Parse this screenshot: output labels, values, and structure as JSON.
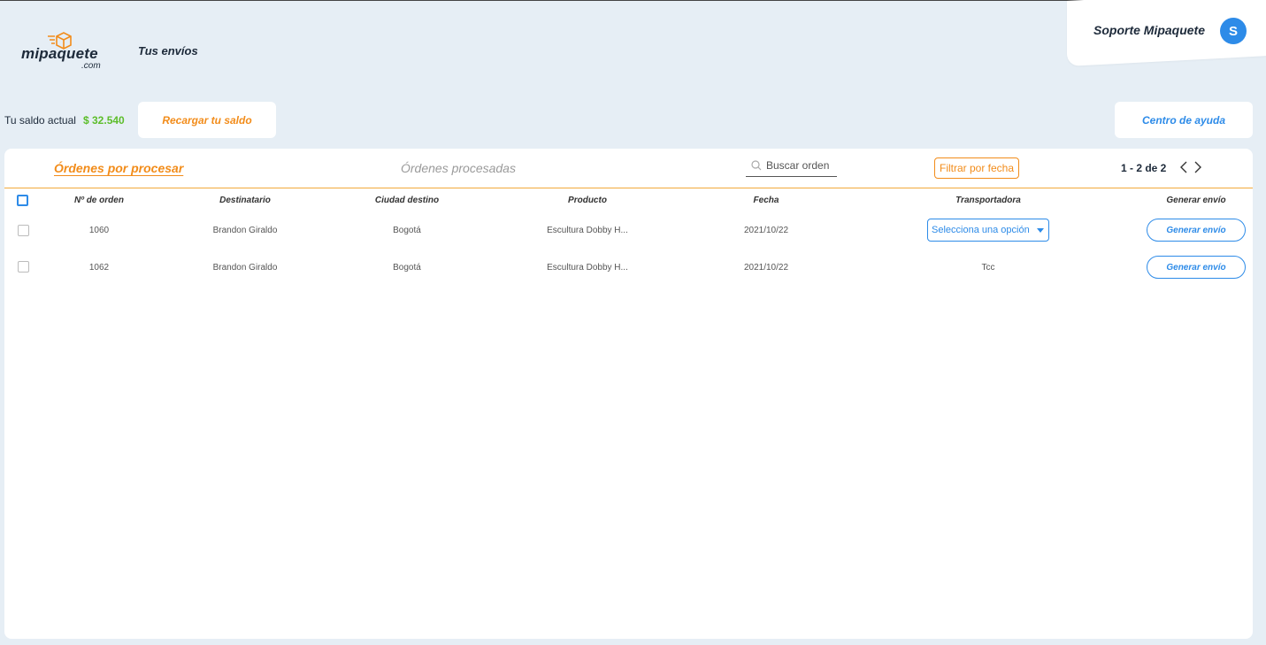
{
  "header": {
    "logo_main": "mipaquete",
    "logo_suffix": ".com",
    "page_title": "Tus envíos",
    "support_name": "Soporte Mipaquete",
    "avatar_initial": "S"
  },
  "balance": {
    "label": "Tu saldo actual",
    "value": "$ 32.540",
    "recharge_label": "Recargar tu saldo",
    "help_label": "Centro de ayuda"
  },
  "tabs": {
    "active": "Órdenes por procesar",
    "inactive": "Órdenes procesadas"
  },
  "search": {
    "placeholder": "Buscar orden"
  },
  "filter_label": "Filtrar por fecha",
  "pager": {
    "text": "1 - 2 de 2"
  },
  "table": {
    "headers": [
      "Nº de orden",
      "Destinatario",
      "Ciudad destino",
      "Producto",
      "Fecha",
      "Transportadora",
      "Generar envío"
    ],
    "rows": [
      {
        "order": "1060",
        "recipient": "Brandon Giraldo",
        "city": "Bogotá",
        "product": "Escultura Dobby H...",
        "date": "2021/10/22",
        "carrier": "Selecciona una opción",
        "action": "Generar envío"
      },
      {
        "order": "1062",
        "recipient": "Brandon Giraldo",
        "city": "Bogotá",
        "product": "Escultura Dobby H...",
        "date": "2021/10/22",
        "carrier": "Tcc",
        "action": "Generar envío"
      }
    ]
  },
  "colors": {
    "accent": "#f28c1a",
    "primary": "#2d8be8",
    "balance": "#5cbd2a",
    "background": "#e6eef5"
  },
  "icons": [
    "box-icon",
    "avatar",
    "search-icon",
    "chevron-left-icon",
    "chevron-right-icon",
    "caret-down-icon"
  ]
}
